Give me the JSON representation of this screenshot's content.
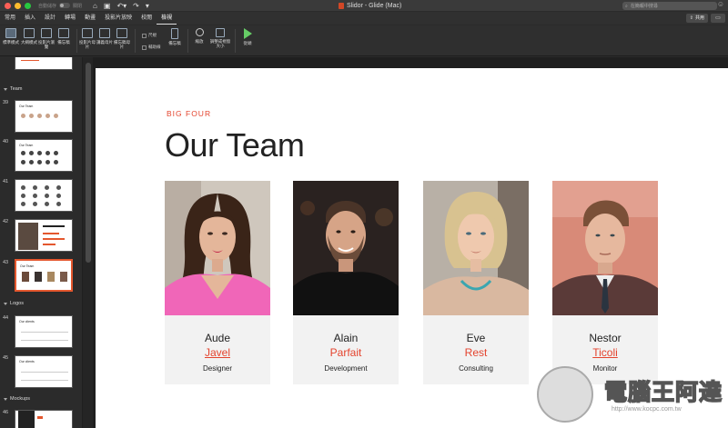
{
  "titlebar": {
    "autosave_label": "自動儲存",
    "autosave_state": "關閉",
    "doc_title": "Slidor - Glide (Mac)",
    "search_placeholder": "在簡報中搜尋"
  },
  "tabs": [
    "常用",
    "插入",
    "設計",
    "轉場",
    "動畫",
    "投影片放映",
    "校閱",
    "檢視"
  ],
  "active_tab": "檢視",
  "share_label": "共用",
  "ribbon": {
    "normal": "標準模式",
    "outline": "大綱模式",
    "sorter": "投影片瀏覽",
    "notes_page": "備忘稿",
    "slide_master": "投影片母片",
    "handout_master": "講義母片",
    "notes_master": "備忘稿母片",
    "ruler": "尺規",
    "guides": "輔助線",
    "notes": "備忘稿",
    "zoom": "縮放",
    "fit": "調整成視窗大小",
    "from_start": "從頭"
  },
  "sidebar": {
    "sections": [
      "Team",
      "Logos",
      "Mockups"
    ],
    "slide_numbers": [
      "39",
      "40",
      "41",
      "42",
      "43",
      "44",
      "45",
      "46"
    ],
    "thumb_titles": [
      "Our Team",
      "Our Team",
      "",
      "",
      "Our Team",
      "Our clients",
      "Our clients",
      ""
    ],
    "selected": "43"
  },
  "slide": {
    "eyebrow": "BIG FOUR",
    "title": "Our Team",
    "members": [
      {
        "first": "Aude",
        "last": "Javel",
        "role": "Designer"
      },
      {
        "first": "Alain",
        "last": "Parfait",
        "role": "Development"
      },
      {
        "first": "Eve",
        "last": "Rest",
        "role": "Consulting"
      },
      {
        "first": "Nestor",
        "last": "Ticoli",
        "role": "Monitor"
      }
    ]
  },
  "watermark": {
    "text": "電腦王阿達",
    "url": "http://www.kocpc.com.tw"
  },
  "colors": {
    "accent": "#e4432d",
    "chrome": "#2b2b2b"
  }
}
